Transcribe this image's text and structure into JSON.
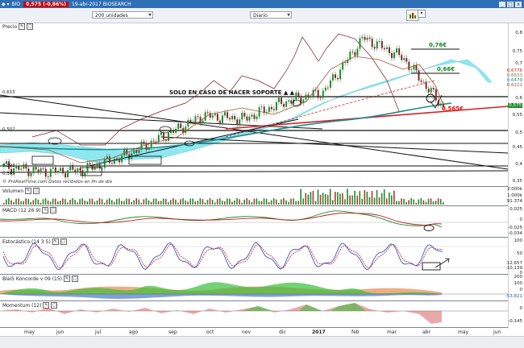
{
  "titlebar": {
    "symbol": "BIO",
    "price_change": "0,575 (-0,86%)",
    "subtitle": "19-abr-2017 BIOSEARCH",
    "minimize": "_",
    "maximize": "□",
    "close": "x"
  },
  "toolbar": {
    "units_select": "200 unidades",
    "period_select": "Diario"
  },
  "panels": {
    "price": {
      "label": "Precio"
    },
    "volume": {
      "label": "Volumen"
    },
    "macd": {
      "label": "MACD (12 26 9)"
    },
    "stoch": {
      "label": "Estocástico (14 3 5)"
    },
    "konc": {
      "label": "Blai5 Koncorde v 09 (15)"
    },
    "mom": {
      "label": "Momentum (12)"
    }
  },
  "notes": {
    "prorealtime": "© ProRealTime.com Datos recibidos en fin de día"
  },
  "annotations": {
    "support": "SOLO EN CASO DE HACER SOPORTE ▲ ▲",
    "target1": "0,76€",
    "target2": "0,66€",
    "target3": "0,565€"
  },
  "price_axis": [
    "0,8",
    "0,75",
    "0,7",
    "0,65",
    "0,6",
    "0,55",
    "0,5",
    "0,45",
    "0,4",
    "0,35"
  ],
  "price_tags": [
    "0,6776",
    "0,6633",
    "0,6479",
    "0,6221",
    "0,575",
    "0,570",
    "0,565"
  ],
  "left_levels": [
    "0,615",
    "0,502",
    "0,398",
    "0,385"
  ],
  "volume_axis": [
    "2.000k",
    "1.000k",
    "91.374"
  ],
  "macd_axis": [
    "0,025",
    "0",
    "-0,025",
    "-0,034"
  ],
  "stoch_axis": [
    "100",
    "50",
    "12,657",
    "10,139",
    "0"
  ],
  "konc_axis": [
    "200",
    "100",
    "0",
    "-100",
    "-53,821"
  ],
  "mom_axis": [
    "0",
    "-0,145"
  ],
  "months": [
    "may",
    "jun",
    "jul",
    "ago",
    "sep",
    "oct",
    "nov",
    "dic",
    "2017",
    "feb",
    "mar",
    "abr",
    "may",
    "jun"
  ],
  "colors": {
    "title_bar": "#2f6fb5",
    "support_line": "#d62020",
    "ema_teal": "#1a8c8c",
    "kumo": "#8fe8f0",
    "candle_up": "#1d8c2a",
    "candle_down": "#7a2c2c"
  },
  "chart_data": {
    "type": "line",
    "title": "BIO",
    "series": [
      {
        "name": "Precio",
        "x": [
          "may",
          "jun",
          "jul",
          "ago",
          "sep",
          "oct",
          "nov",
          "dic",
          "2017",
          "feb",
          "mar",
          "abr"
        ],
        "values": [
          0.4,
          0.385,
          0.39,
          0.43,
          0.49,
          0.55,
          0.54,
          0.59,
          0.62,
          0.78,
          0.72,
          0.575
        ]
      }
    ],
    "ylim": [
      0.35,
      0.82
    ]
  }
}
